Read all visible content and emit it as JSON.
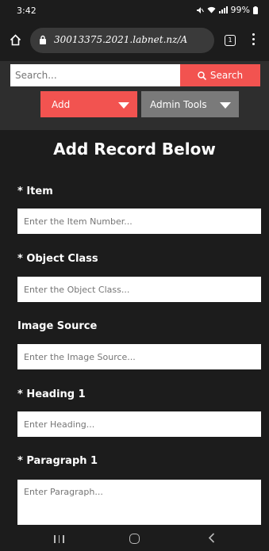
{
  "status": {
    "time": "3:42",
    "battery": "99%"
  },
  "browser": {
    "url": "30013375.2021.labnet.nz/A",
    "tab_count": "1"
  },
  "search": {
    "placeholder": "Search...",
    "button_label": "Search"
  },
  "menu": {
    "add_label": "Add",
    "admin_label": "Admin Tools"
  },
  "form": {
    "title": "Add Record Below",
    "fields": [
      {
        "label": "* Item",
        "placeholder": "Enter the Item Number..."
      },
      {
        "label": "* Object Class",
        "placeholder": "Enter the Object Class..."
      },
      {
        "label": "Image Source",
        "placeholder": "Enter the Image Source..."
      },
      {
        "label": "* Heading 1",
        "placeholder": "Enter Heading..."
      },
      {
        "label": "* Paragraph 1",
        "placeholder": "Enter Paragraph..."
      }
    ]
  },
  "colors": {
    "accent": "#f25350",
    "admin": "#7a7a7a",
    "background": "#2e2e2e",
    "form_bg": "#1c1c1c"
  },
  "icons": [
    "home-icon",
    "lock-icon",
    "tabs-icon",
    "more-vert-icon",
    "search-icon",
    "recent-apps-icon",
    "home-nav-icon",
    "back-icon"
  ]
}
